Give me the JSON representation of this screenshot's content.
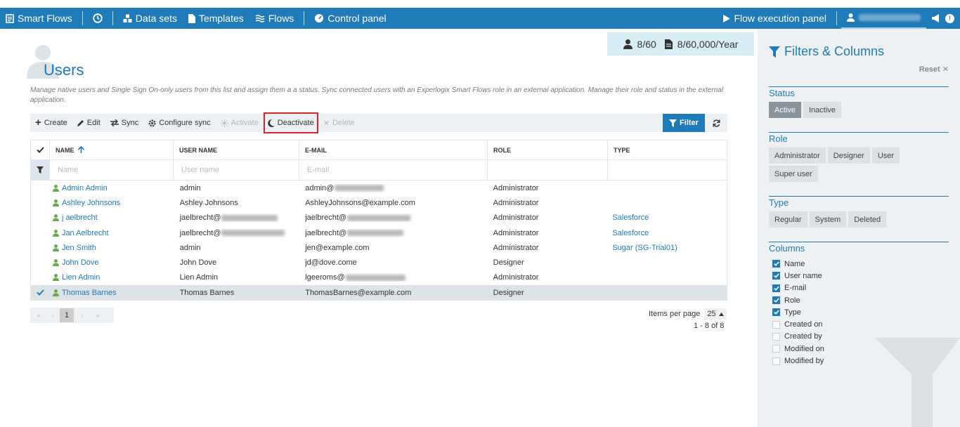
{
  "nav": {
    "brand": "Smart Flows",
    "datasets": "Data sets",
    "templates": "Templates",
    "flows": "Flows",
    "control_panel": "Control panel",
    "flow_execution_panel": "Flow execution panel",
    "notification_badge": "!"
  },
  "quota": {
    "users": "8/60",
    "documents": "8/60,000/Year"
  },
  "page": {
    "title": "Users",
    "description": "Manage native users and Single Sign On-only users from this list and assign them a a status. Sync connected users with an Experlogix Smart Flows role in an external application. Manage their role and status in the external application."
  },
  "toolbar": {
    "create": "Create",
    "edit": "Edit",
    "sync": "Sync",
    "configure_sync": "Configure sync",
    "activate": "Activate",
    "deactivate": "Deactivate",
    "delete": "Delete",
    "filter": "Filter"
  },
  "grid": {
    "headers": [
      "NAME",
      "USER NAME",
      "E-MAIL",
      "ROLE",
      "TYPE"
    ],
    "filter_placeholders": {
      "name": "Name",
      "username": "User name",
      "email": "E-mail"
    },
    "rows": [
      {
        "name": "Admin Admin",
        "username": "admin",
        "email": "admin@",
        "email_blurred": true,
        "role": "Administrator",
        "type": ""
      },
      {
        "name": "Ashley Johnsons",
        "username": "Ashley Johnsons",
        "email": "AshleyJohnsons@example.com",
        "role": "Administrator",
        "type": ""
      },
      {
        "name": "j aelbrecht",
        "username": "jaelbrecht@",
        "username_blurred": true,
        "email": "jaelbrecht@",
        "email_blurred": true,
        "role": "Administrator",
        "type": "Salesforce"
      },
      {
        "name": "Jan Aelbrecht",
        "username": "jaelbrecht@",
        "username_blurred": true,
        "email": "jaelbrecht@",
        "email_blurred": true,
        "role": "Administrator",
        "type": "Salesforce"
      },
      {
        "name": "Jen Smith",
        "username": "admin",
        "email": "jen@example.com",
        "role": "Administrator",
        "type": "Sugar (SG-Trial01)"
      },
      {
        "name": "John Dove",
        "username": "John Dove",
        "email": "jd@dove.come",
        "role": "Designer",
        "type": ""
      },
      {
        "name": "Lien Admin",
        "username": "Lien Admin",
        "email": "lgeeroms@",
        "email_blurred": true,
        "role": "Administrator",
        "type": ""
      },
      {
        "name": "Thomas Barnes",
        "username": "Thomas Barnes",
        "email": "ThomasBarnes@example.com",
        "role": "Designer",
        "type": "",
        "selected": true
      }
    ]
  },
  "pager": {
    "first": "«",
    "prev": "‹",
    "current": "1",
    "next": "›",
    "last": "»",
    "items_per_page_label": "Items per page",
    "items_per_page": "25",
    "count": "1 - 8 of 8"
  },
  "filters": {
    "title": "Filters & Columns",
    "reset": "Reset",
    "status": {
      "label": "Status",
      "options": [
        "Active",
        "Inactive"
      ],
      "active": "Active"
    },
    "role": {
      "label": "Role",
      "options": [
        "Administrator",
        "Designer",
        "User",
        "Super user"
      ]
    },
    "type": {
      "label": "Type",
      "options": [
        "Regular",
        "System",
        "Deleted"
      ]
    },
    "columns": {
      "label": "Columns",
      "items": [
        {
          "label": "Name",
          "checked": true
        },
        {
          "label": "User name",
          "checked": true
        },
        {
          "label": "E-mail",
          "checked": true
        },
        {
          "label": "Role",
          "checked": true
        },
        {
          "label": "Type",
          "checked": true
        },
        {
          "label": "Created on",
          "checked": false
        },
        {
          "label": "Created by",
          "checked": false
        },
        {
          "label": "Modified on",
          "checked": false
        },
        {
          "label": "Modified by",
          "checked": false
        }
      ]
    }
  },
  "colors": {
    "primary": "#1f7ab8",
    "user_icon": "#6aa84f",
    "highlight_border": "#d9252b"
  }
}
